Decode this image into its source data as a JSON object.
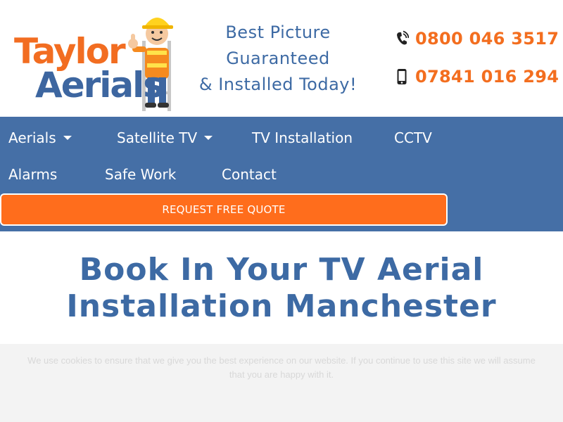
{
  "brand": {
    "logo_line1": "Taylor",
    "logo_line2": "Aerials"
  },
  "tagline": {
    "line1": "Best Picture",
    "line2": "Guaranteed",
    "line3": "& Installed Today!"
  },
  "contact": {
    "landline": "0800 046 3517",
    "mobile": "07841 016 294",
    "landline_icon": "phone-ringing-icon",
    "mobile_icon": "mobile-phone-icon"
  },
  "nav": {
    "items": [
      {
        "label": "Aerials",
        "has_dropdown": true
      },
      {
        "label": "Satellite TV",
        "has_dropdown": true
      },
      {
        "label": "TV Installation",
        "has_dropdown": false
      },
      {
        "label": "CCTV",
        "has_dropdown": false
      },
      {
        "label": "Alarms",
        "has_dropdown": false
      },
      {
        "label": "Safe Work",
        "has_dropdown": false
      },
      {
        "label": "Contact",
        "has_dropdown": false
      }
    ],
    "cta_label": "REQUEST FREE QUOTE"
  },
  "main": {
    "heading_line1": "Book In Your TV Aerial",
    "heading_line2": "Installation Manchester"
  },
  "cookie": {
    "text": "We use cookies to ensure that we give you the best experience on our website. If you continue to use this site we will assume that you are happy with it."
  },
  "colors": {
    "brand_blue": "#456fa6",
    "heading_blue": "#3d6aa4",
    "accent_orange": "#ff6d1c",
    "phone_orange": "#f36e1f"
  }
}
